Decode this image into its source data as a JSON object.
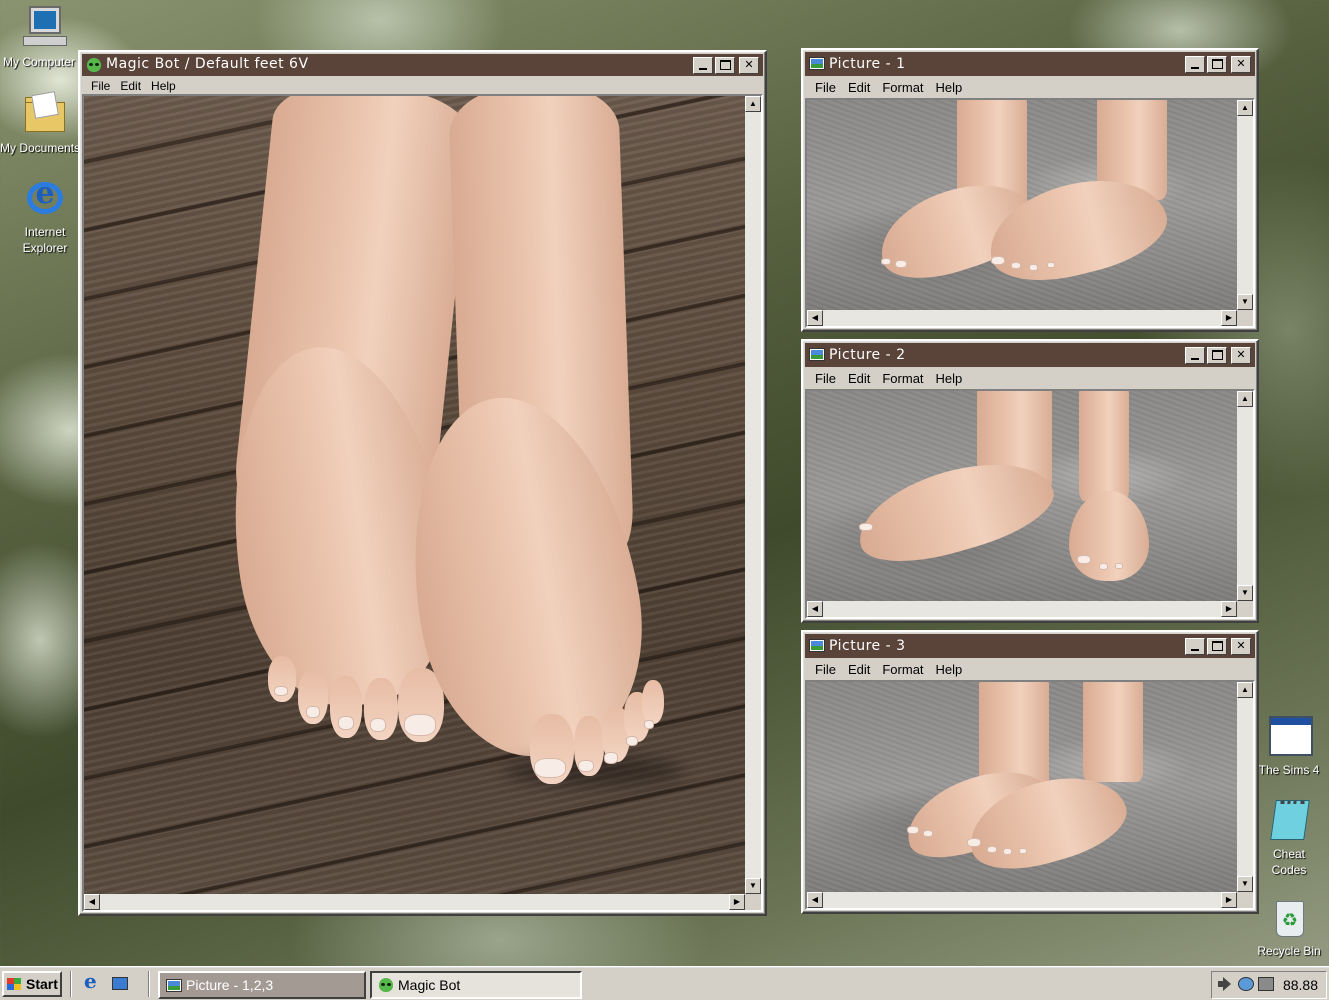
{
  "desktop": {
    "icons_left": [
      {
        "name": "my-computer",
        "label": "My Computer"
      },
      {
        "name": "my-documents",
        "label": "My Documents"
      },
      {
        "name": "internet-explorer",
        "label_line1": "Internet",
        "label_line2": "Explorer"
      }
    ],
    "icons_right": [
      {
        "name": "the-sims-4",
        "label": "The Sims 4"
      },
      {
        "name": "cheat-codes",
        "label_line1": "Cheat",
        "label_line2": "Codes"
      },
      {
        "name": "recycle-bin",
        "label": "Recycle Bin"
      }
    ]
  },
  "main_window": {
    "title": "Magic Bot / Default feet 6V",
    "menu": [
      "File",
      "Edit",
      "Help"
    ],
    "icon": "alien-icon"
  },
  "picture_windows": [
    {
      "title": "Picture - 1",
      "menu": [
        "File",
        "Edit",
        "Format",
        "Help"
      ],
      "icon": "picture-icon"
    },
    {
      "title": "Picture - 2",
      "menu": [
        "File",
        "Edit",
        "Format",
        "Help"
      ],
      "icon": "picture-icon"
    },
    {
      "title": "Picture - 3",
      "menu": [
        "File",
        "Edit",
        "Format",
        "Help"
      ],
      "icon": "picture-icon"
    }
  ],
  "taskbar": {
    "start_label": "Start",
    "tasks": [
      {
        "label": "Picture - 1,2,3",
        "icon": "picture-icon",
        "active": false
      },
      {
        "label": "Magic Bot",
        "icon": "alien-icon",
        "active": true
      }
    ],
    "clock": "88.88"
  },
  "colors": {
    "titlebar": "#5a4339",
    "window_face": "#d4d0c8"
  }
}
